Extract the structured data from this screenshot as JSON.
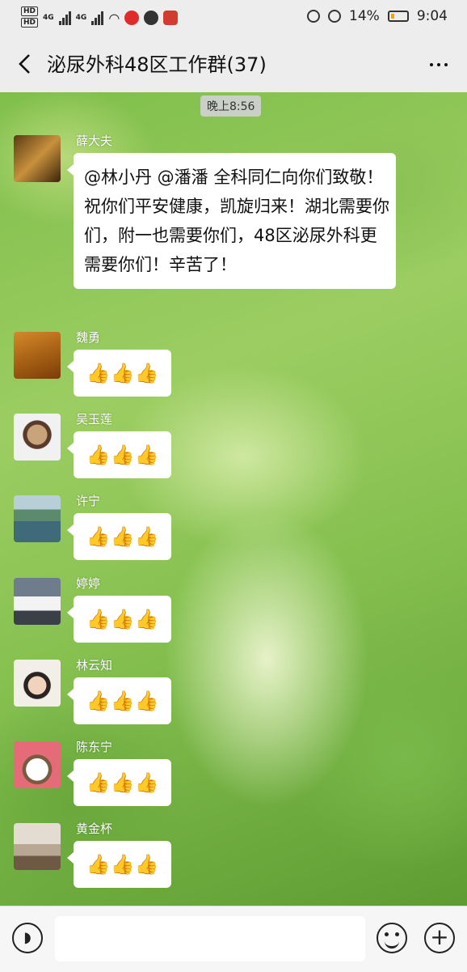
{
  "status_bar": {
    "hd_top": "HD",
    "hd_bottom": "HD",
    "network_1": "4G",
    "network_2": "4G",
    "battery_percent": "14%",
    "time": "9:04"
  },
  "header": {
    "title": "泌尿外科48区工作群(37)"
  },
  "chat": {
    "timestamp": "晚上8:56",
    "messages": [
      {
        "sender": "薛大夫",
        "text": "@林小丹  @潘潘   全科同仁向你们致敬！祝你们平安健康，凯旋归来！湖北需要你们，附一也需要你们，48区泌尿外科更需要你们！辛苦了！"
      },
      {
        "sender": "魏勇",
        "text": "👍👍👍"
      },
      {
        "sender": "吴玉莲",
        "text": "👍👍👍"
      },
      {
        "sender": "许宁",
        "text": "👍👍👍"
      },
      {
        "sender": "婷婷",
        "text": "👍👍👍"
      },
      {
        "sender": "林云知",
        "text": "👍👍👍"
      },
      {
        "sender": "陈东宁",
        "text": "👍👍👍"
      },
      {
        "sender": "黄金杯",
        "text": "👍👍👍"
      }
    ]
  },
  "input_bar": {
    "value": ""
  }
}
